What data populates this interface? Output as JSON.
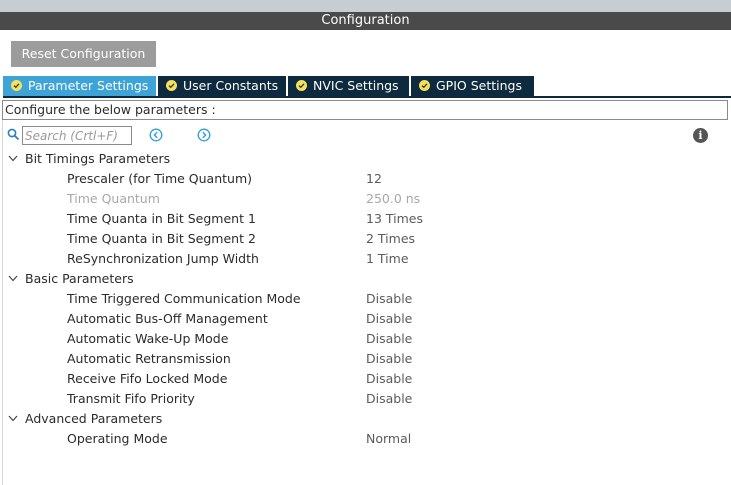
{
  "window": {
    "title": "Configuration"
  },
  "toolbar": {
    "reset_label": "Reset Configuration"
  },
  "tabs": [
    {
      "label": "Parameter Settings",
      "active": true
    },
    {
      "label": "User Constants",
      "active": false
    },
    {
      "label": "NVIC Settings",
      "active": false
    },
    {
      "label": "GPIO Settings",
      "active": false
    }
  ],
  "description": "Configure the below parameters :",
  "search": {
    "placeholder": "Search (Crtl+F)"
  },
  "groups": [
    {
      "label": "Bit Timings Parameters",
      "params": [
        {
          "name": "Prescaler (for Time Quantum)",
          "value": "12"
        },
        {
          "name": "Time Quantum",
          "value": "250.0 ns",
          "disabled": true
        },
        {
          "name": "Time Quanta in Bit Segment 1",
          "value": "13 Times"
        },
        {
          "name": "Time Quanta in Bit Segment 2",
          "value": "2 Times"
        },
        {
          "name": "ReSynchronization Jump Width",
          "value": "1 Time"
        }
      ]
    },
    {
      "label": "Basic Parameters",
      "params": [
        {
          "name": "Time Triggered Communication Mode",
          "value": "Disable"
        },
        {
          "name": "Automatic Bus-Off Management",
          "value": "Disable"
        },
        {
          "name": "Automatic Wake-Up Mode",
          "value": "Disable"
        },
        {
          "name": "Automatic Retransmission",
          "value": "Disable"
        },
        {
          "name": "Receive Fifo Locked Mode",
          "value": "Disable"
        },
        {
          "name": "Transmit Fifo Priority",
          "value": "Disable"
        }
      ]
    },
    {
      "label": "Advanced Parameters",
      "params": [
        {
          "name": "Operating Mode",
          "value": "Normal"
        }
      ]
    }
  ],
  "colors": {
    "title_bar": "#4a4a4a",
    "tab_active": "#3ea3d6",
    "tab_inactive": "#0e2a3f",
    "tab_check": "#f5e15a",
    "reset_button": "#9c9c9c"
  },
  "icons": {
    "search": "search-icon",
    "prev": "arrow-left-circle-icon",
    "next": "arrow-right-circle-icon",
    "info": "info-icon",
    "group_toggle": "chevron-down-icon",
    "tab_status": "check-circle-icon"
  }
}
